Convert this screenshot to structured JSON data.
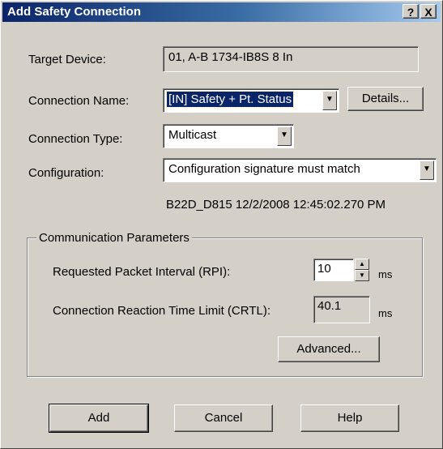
{
  "window": {
    "title": "Add Safety Connection",
    "help_btn": "?",
    "close_btn": "X"
  },
  "fields": {
    "target_device_label": "Target Device:",
    "target_device_value": "01, A-B 1734-IB8S 8 In",
    "connection_name_label": "Connection Name:",
    "connection_name_value": "[IN] Safety + Pt. Status",
    "details_button": "Details...",
    "connection_type_label": "Connection Type:",
    "connection_type_value": "Multicast",
    "configuration_label": "Configuration:",
    "configuration_value": "Configuration signature must match",
    "signature": "B22D_D815 12/2/2008 12:45:02.270 PM"
  },
  "comm": {
    "group_title": "Communication Parameters",
    "rpi_label": "Requested Packet Interval (RPI):",
    "rpi_value": "10",
    "rpi_unit": "ms",
    "crtl_label": "Connection Reaction Time Limit (CRTL):",
    "crtl_value": "40.1",
    "crtl_unit": "ms",
    "advanced_button": "Advanced..."
  },
  "buttons": {
    "add": "Add",
    "cancel": "Cancel",
    "help": "Help"
  },
  "icons": {
    "dropdown": "chevron-down-icon",
    "spin_up": "spin-up-icon",
    "spin_down": "spin-down-icon"
  }
}
